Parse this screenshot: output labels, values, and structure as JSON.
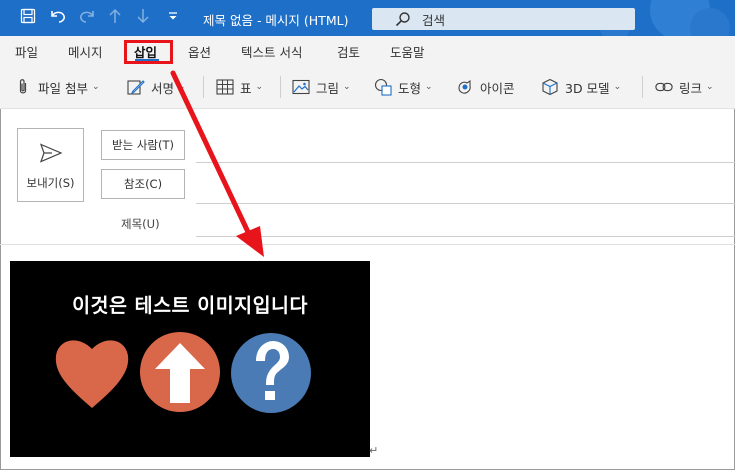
{
  "window": {
    "title": "제목 없음  -  메시지 (HTML)",
    "search_placeholder": "검색",
    "accent": "#1e6fc7"
  },
  "quick_access": [
    "save-icon",
    "undo-icon",
    "redo-icon",
    "up-icon",
    "down-icon",
    "customize-icon"
  ],
  "menu": {
    "tabs": [
      {
        "label": "파일"
      },
      {
        "label": "메시지"
      },
      {
        "label": "삽입",
        "active": true
      },
      {
        "label": "옵션"
      },
      {
        "label": "텍스트 서식"
      },
      {
        "label": "검토"
      },
      {
        "label": "도움말"
      }
    ]
  },
  "ribbon": {
    "attach": "파일 첨부",
    "signature": "서명",
    "table": "표",
    "pictures": "그림",
    "shapes": "도형",
    "icons": "아이콘",
    "model3d": "3D 모델",
    "link": "링크"
  },
  "compose": {
    "send_label": "보내기(S)",
    "to_label": "받는 사람(T)",
    "cc_label": "참조(C)",
    "subject_label": "제목(U)"
  },
  "body": {
    "image_text": "이것은 테스트 이미지입니다",
    "image_icons": [
      "heart-icon",
      "up-arrow-icon",
      "question-icon"
    ],
    "image_colors": {
      "heart": "#d9674a",
      "arrow_circle": "#d9674a",
      "question_circle": "#4a7bb5"
    },
    "paragraph_mark": "↵"
  },
  "annotation": {
    "highlight_color": "#e8141b"
  }
}
